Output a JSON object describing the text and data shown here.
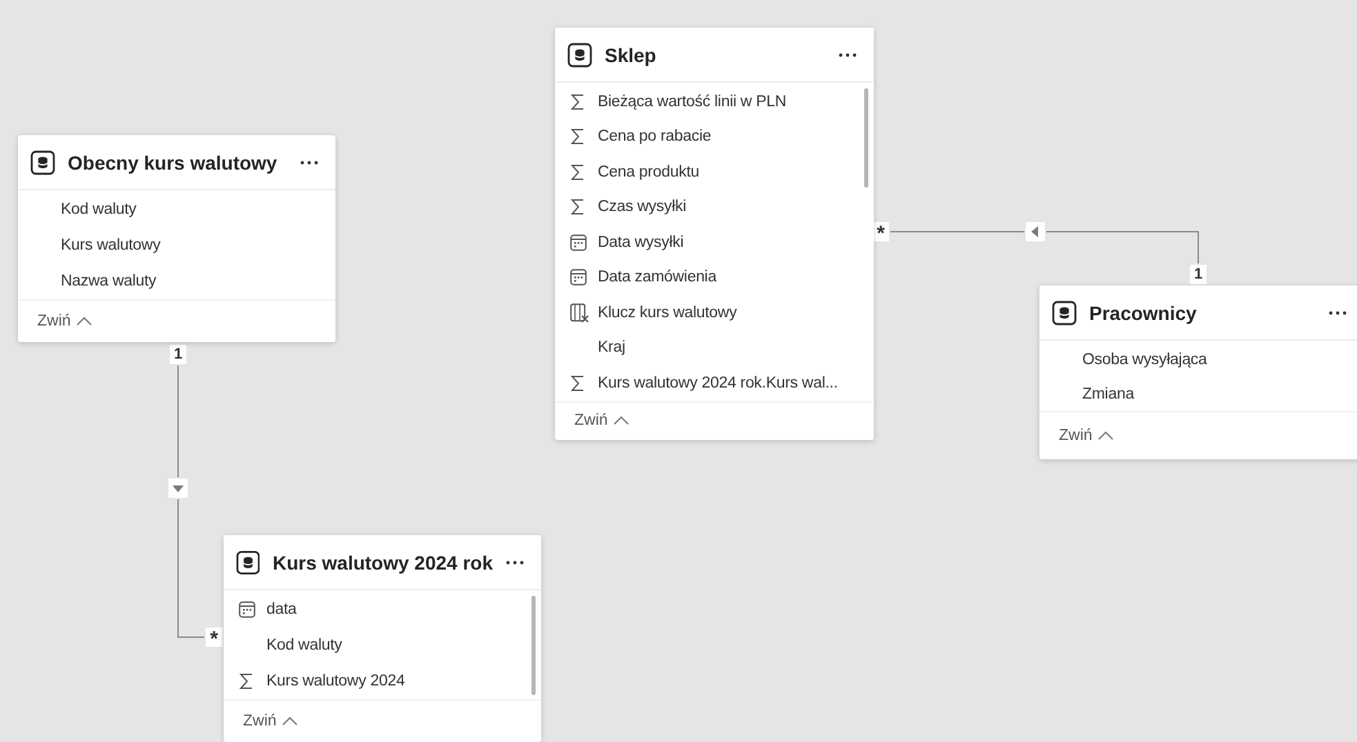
{
  "tables": [
    {
      "title": "Obecny kurs walutowy",
      "scrollable": false,
      "fields": [
        {
          "name": "Kod waluty",
          "kind": "plain"
        },
        {
          "name": "Kurs walutowy",
          "kind": "plain"
        },
        {
          "name": "Nazwa waluty",
          "kind": "plain"
        }
      ],
      "collapse": "Zwiń"
    },
    {
      "title": "Sklep",
      "scrollable": true,
      "fields": [
        {
          "name": "Bieżąca wartość linii w PLN",
          "kind": "sum"
        },
        {
          "name": "Cena po rabacie",
          "kind": "sum"
        },
        {
          "name": "Cena produktu",
          "kind": "sum"
        },
        {
          "name": "Czas wysyłki",
          "kind": "sum"
        },
        {
          "name": "Data wysyłki",
          "kind": "date"
        },
        {
          "name": "Data zamówienia",
          "kind": "date"
        },
        {
          "name": "Klucz kurs walutowy",
          "kind": "calc"
        },
        {
          "name": "Kraj",
          "kind": "plain"
        },
        {
          "name": "Kurs walutowy 2024 rok.Kurs wal...",
          "kind": "sum"
        }
      ],
      "collapse": "Zwiń"
    },
    {
      "title": "Pracownicy",
      "scrollable": false,
      "fields": [
        {
          "name": "Osoba wysyłająca",
          "kind": "plain"
        },
        {
          "name": "Zmiana",
          "kind": "plain"
        }
      ],
      "collapse": "Zwiń"
    },
    {
      "title": "Kurs walutowy 2024 rok",
      "scrollable": true,
      "fields": [
        {
          "name": "data",
          "kind": "date"
        },
        {
          "name": "Kod waluty",
          "kind": "plain"
        },
        {
          "name": "Kurs walutowy 2024",
          "kind": "sum"
        }
      ],
      "collapse": "Zwiń"
    }
  ],
  "relationships": [
    {
      "one": "1",
      "many": "*",
      "kind": "down"
    },
    {
      "one": "1",
      "many": "*",
      "kind": "left"
    }
  ]
}
